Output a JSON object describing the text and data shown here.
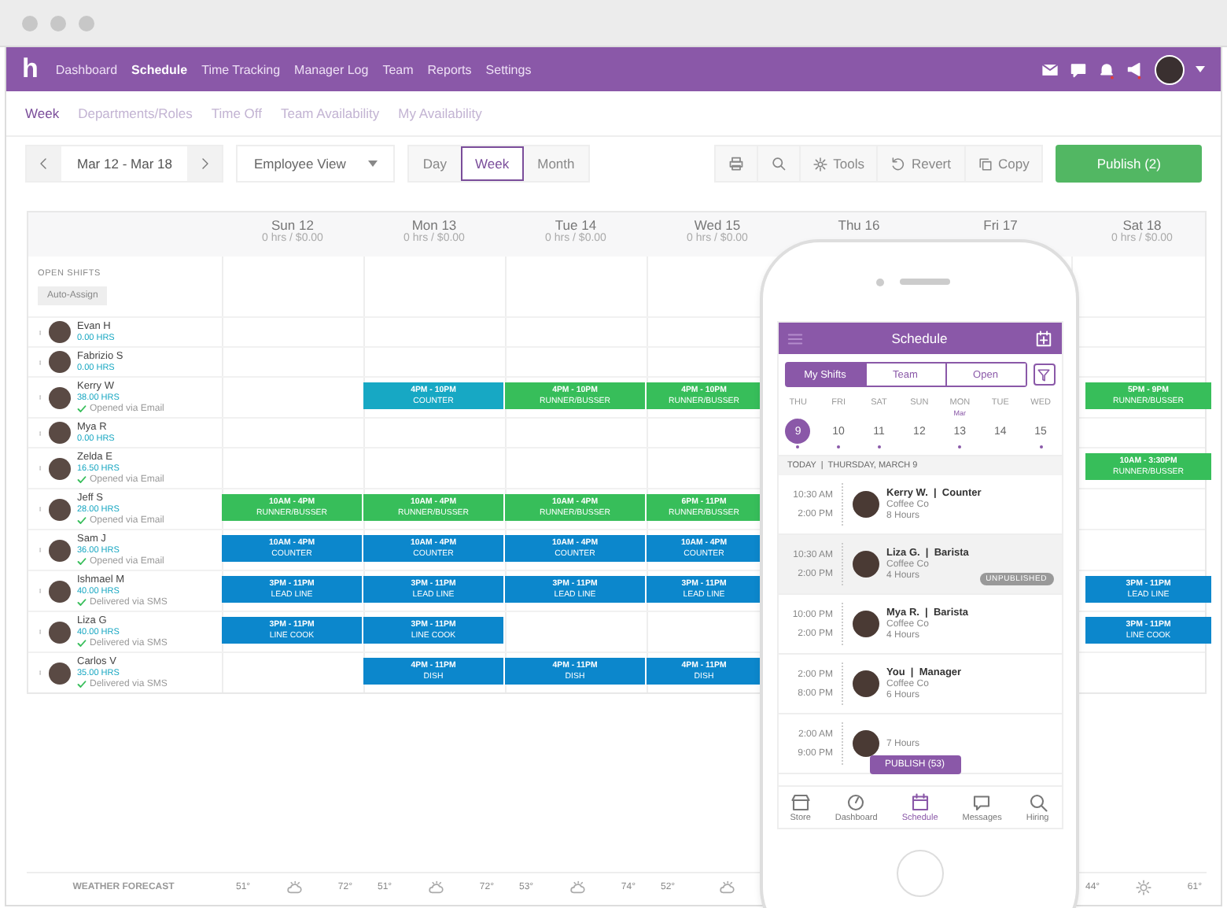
{
  "nav": {
    "logo": "h",
    "items": [
      {
        "label": "Dashboard",
        "selected": false
      },
      {
        "label": "Schedule",
        "selected": true
      },
      {
        "label": "Time Tracking",
        "selected": false
      },
      {
        "label": "Manager Log",
        "selected": false
      },
      {
        "label": "Team",
        "selected": false
      },
      {
        "label": "Reports",
        "selected": false
      },
      {
        "label": "Settings",
        "selected": false
      }
    ]
  },
  "subnav": [
    {
      "label": "Week",
      "selected": true
    },
    {
      "label": "Departments/Roles",
      "selected": false
    },
    {
      "label": "Time Off",
      "selected": false
    },
    {
      "label": "Team Availability",
      "selected": false
    },
    {
      "label": "My Availability",
      "selected": false
    }
  ],
  "toolbar": {
    "date_range": "Mar 12 - Mar 18",
    "view_select": "Employee View",
    "range_tabs": [
      {
        "label": "Day",
        "selected": false
      },
      {
        "label": "Week",
        "selected": true
      },
      {
        "label": "Month",
        "selected": false
      }
    ],
    "actions": [
      {
        "kind": "print"
      },
      {
        "kind": "search"
      },
      {
        "kind": "tools",
        "label": "Tools"
      },
      {
        "kind": "revert",
        "label": "Revert"
      },
      {
        "kind": "copy",
        "label": "Copy"
      }
    ],
    "publish": "Publish (2)"
  },
  "schedule": {
    "days": [
      {
        "label": "Sun 12",
        "summary": "0 hrs / $0.00",
        "weather": {
          "low": "51°",
          "high": "72°",
          "kind": "cloudy"
        }
      },
      {
        "label": "Mon 13",
        "summary": "0 hrs / $0.00",
        "weather": {
          "low": "51°",
          "high": "72°",
          "kind": "cloudy"
        }
      },
      {
        "label": "Tue 14",
        "summary": "0 hrs / $0.00",
        "weather": {
          "low": "53°",
          "high": "74°",
          "kind": "cloudy"
        }
      },
      {
        "label": "Wed 15",
        "summary": "0 hrs / $0.00",
        "weather": {
          "low": "52°",
          "kind": "cloudy"
        }
      },
      {
        "label": "Thu 16"
      },
      {
        "label": "Fri 17"
      },
      {
        "label": "Sat 18",
        "summary": "0 hrs / $0.00",
        "weather": {
          "low": "44°",
          "high": "61°",
          "kind": "sunny"
        }
      }
    ],
    "open_shifts": {
      "title": "OPEN SHIFTS",
      "button": "Auto-Assign"
    },
    "employees": [
      {
        "name": "Evan H",
        "hours": "0.00 HRS"
      },
      {
        "name": "Fabrizio S",
        "hours": "0.00 HRS"
      },
      {
        "name": "Kerry W",
        "hours": "38.00 HRS",
        "note": "Opened via Email",
        "shifts": {
          "mon": {
            "time": "4PM - 10PM",
            "role": "COUNTER",
            "color": "#17a8c4"
          },
          "tue": {
            "time": "4PM - 10PM",
            "role": "RUNNER/BUSSER",
            "color": "#37be5a"
          },
          "wed": {
            "time": "4PM - 10PM",
            "role": "RUNNER/BUSSER",
            "color": "#37be5a"
          },
          "sat": {
            "time": "5PM - 9PM",
            "role": "RUNNER/BUSSER",
            "color": "#37be5a"
          }
        }
      },
      {
        "name": "Mya R",
        "hours": "0.00 HRS"
      },
      {
        "name": "Zelda E",
        "hours": "16.50 HRS",
        "note": "Opened via Email",
        "shifts": {
          "sat": {
            "time": "10AM - 3:30PM",
            "role": "RUNNER/BUSSER",
            "color": "#37be5a"
          }
        }
      },
      {
        "name": "Jeff S",
        "hours": "28.00 HRS",
        "note": "Opened via Email",
        "shifts": {
          "sun": {
            "time": "10AM - 4PM",
            "role": "RUNNER/BUSSER",
            "color": "#37be5a"
          },
          "mon": {
            "time": "10AM - 4PM",
            "role": "RUNNER/BUSSER",
            "color": "#37be5a"
          },
          "tue": {
            "time": "10AM - 4PM",
            "role": "RUNNER/BUSSER",
            "color": "#37be5a"
          },
          "wed": {
            "time": "6PM - 11PM",
            "role": "RUNNER/BUSSER",
            "color": "#37be5a"
          }
        }
      },
      {
        "name": "Sam J",
        "hours": "36.00 HRS",
        "note": "Opened via Email",
        "shifts": {
          "sun": {
            "time": "10AM - 4PM",
            "role": "COUNTER",
            "color": "#0c87cc"
          },
          "mon": {
            "time": "10AM - 4PM",
            "role": "COUNTER",
            "color": "#0c87cc"
          },
          "tue": {
            "time": "10AM - 4PM",
            "role": "COUNTER",
            "color": "#0c87cc"
          },
          "wed": {
            "time": "10AM - 4PM",
            "role": "COUNTER",
            "color": "#0c87cc"
          }
        }
      },
      {
        "name": "Ishmael M",
        "hours": "40.00 HRS",
        "note": "Delivered via SMS",
        "shifts": {
          "sun": {
            "time": "3PM - 11PM",
            "role": "LEAD LINE",
            "color": "#0c87cc"
          },
          "mon": {
            "time": "3PM - 11PM",
            "role": "LEAD LINE",
            "color": "#0c87cc"
          },
          "tue": {
            "time": "3PM - 11PM",
            "role": "LEAD LINE",
            "color": "#0c87cc"
          },
          "wed": {
            "time": "3PM - 11PM",
            "role": "LEAD LINE",
            "color": "#0c87cc"
          },
          "sat": {
            "time": "3PM - 11PM",
            "role": "LEAD LINE",
            "color": "#0c87cc"
          }
        }
      },
      {
        "name": "Liza G",
        "hours": "40.00 HRS",
        "note": "Delivered via SMS",
        "shifts": {
          "sun": {
            "time": "3PM - 11PM",
            "role": "LINE COOK",
            "color": "#0c87cc"
          },
          "mon": {
            "time": "3PM - 11PM",
            "role": "LINE COOK",
            "color": "#0c87cc"
          },
          "sat": {
            "time": "3PM - 11PM",
            "role": "LINE COOK",
            "color": "#0c87cc"
          }
        }
      },
      {
        "name": "Carlos V",
        "hours": "35.00 HRS",
        "note": "Delivered via SMS",
        "shifts": {
          "mon": {
            "time": "4PM - 11PM",
            "role": "DISH",
            "color": "#0c87cc"
          },
          "tue": {
            "time": "4PM - 11PM",
            "role": "DISH",
            "color": "#0c87cc"
          },
          "wed": {
            "time": "4PM - 11PM",
            "role": "DISH",
            "color": "#0c87cc"
          }
        }
      }
    ],
    "weather_label": "WEATHER FORECAST"
  },
  "phone": {
    "title": "Schedule",
    "tabs": [
      {
        "label": "My Shifts",
        "selected": true
      },
      {
        "label": "Team",
        "selected": false
      },
      {
        "label": "Open",
        "selected": false
      }
    ],
    "week": [
      {
        "weekday": "THU",
        "date": "9",
        "selected": true,
        "has_shifts": true
      },
      {
        "weekday": "FRI",
        "date": "10",
        "selected": false,
        "has_shifts": true
      },
      {
        "weekday": "SAT",
        "date": "11",
        "selected": false,
        "has_shifts": true
      },
      {
        "weekday": "SUN",
        "date": "12",
        "selected": false,
        "has_shifts": false
      },
      {
        "weekday": "MON",
        "date": "13",
        "month": "Mar",
        "selected": false,
        "has_shifts": true
      },
      {
        "weekday": "TUE",
        "date": "14",
        "selected": false,
        "has_shifts": false
      },
      {
        "weekday": "WED",
        "date": "15",
        "selected": false,
        "has_shifts": true
      }
    ],
    "date_heading": "TODAY  |  THURSDAY, MARCH 9",
    "shifts": [
      {
        "start": "10:30 AM",
        "end": "2:00 PM",
        "title": "Kerry W.  |  Counter",
        "company": "Coffee Co",
        "hours": "8 Hours",
        "selected": false
      },
      {
        "start": "10:30 AM",
        "end": "2:00 PM",
        "title": "Liza G.  |  Barista",
        "company": "Coffee Co",
        "hours": "4 Hours",
        "badge": "UNPUBLISHED",
        "selected": true
      },
      {
        "start": "10:00 PM",
        "end": "2:00 PM",
        "title": "Mya R.  |  Barista",
        "company": "Coffee Co",
        "hours": "4 Hours",
        "selected": false
      },
      {
        "start": "2:00 PM",
        "end": "8:00 PM",
        "title": "You  |  Manager",
        "company": "Coffee Co",
        "hours": "6 Hours",
        "selected": false
      },
      {
        "start": "2:00 AM",
        "end": "9:00 PM",
        "hours": "7 Hours",
        "selected": false
      }
    ],
    "publish": "PUBLISH (53)",
    "tab_bar": [
      {
        "kind": "store",
        "label": "Store",
        "selected": false
      },
      {
        "kind": "dashboard",
        "label": "Dashboard",
        "selected": false
      },
      {
        "kind": "schedule",
        "label": "Schedule",
        "selected": true
      },
      {
        "kind": "messages",
        "label": "Messages",
        "selected": false
      },
      {
        "kind": "hiring",
        "label": "Hiring",
        "selected": false
      }
    ]
  }
}
